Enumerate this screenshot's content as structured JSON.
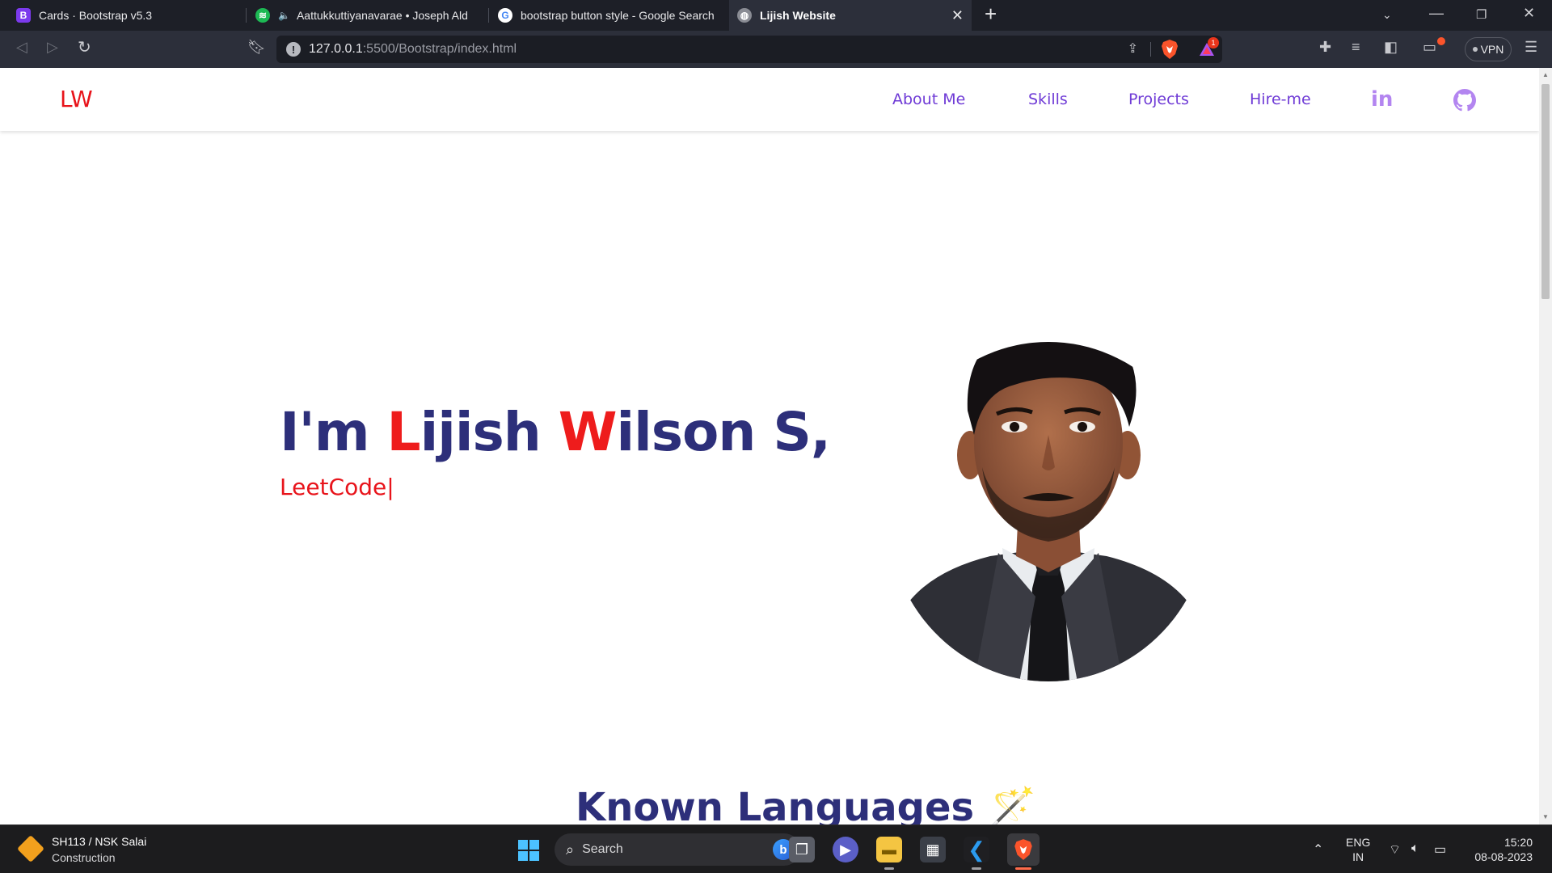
{
  "browser": {
    "tabs": [
      {
        "title": "Cards · Bootstrap v5.3",
        "favicon": "bootstrap-icon",
        "active": false
      },
      {
        "title": "Aattukkuttiyanavarae • Joseph Ald",
        "favicon": "spotify-icon",
        "active": false
      },
      {
        "title": "bootstrap button style - Google Search",
        "favicon": "google-icon",
        "active": false
      },
      {
        "title": "Lijish Website",
        "favicon": "globe-icon",
        "active": true
      }
    ],
    "url_host": "127.0.0.1",
    "url_path": ":5500/Bootstrap/index.html",
    "rewards_badge": "1",
    "vpn_label": "VPN"
  },
  "nav": {
    "brand": "LW",
    "links": [
      "About Me",
      "Skills",
      "Projects",
      "Hire-me"
    ],
    "icons": [
      "linkedin-icon",
      "github-icon"
    ]
  },
  "hero": {
    "title_parts": [
      "I'm ",
      "L",
      "ijish ",
      "W",
      "ilson S,"
    ],
    "typed_text": "LeetCode",
    "cursor": "|"
  },
  "section": {
    "title": "Known Languages",
    "emoji": "🪄"
  },
  "taskbar": {
    "weather_line1": "SH113 / NSK Salai",
    "weather_line2": "Construction",
    "search_label": "Search",
    "lang_line1": "ENG",
    "lang_line2": "IN",
    "time": "15:20",
    "date": "08-08-2023"
  },
  "colors": {
    "brand_red": "#e8141b",
    "title_navy": "#2d2f7a",
    "nav_purple": "#6f3bd6",
    "icon_lavender": "#b385f0"
  }
}
